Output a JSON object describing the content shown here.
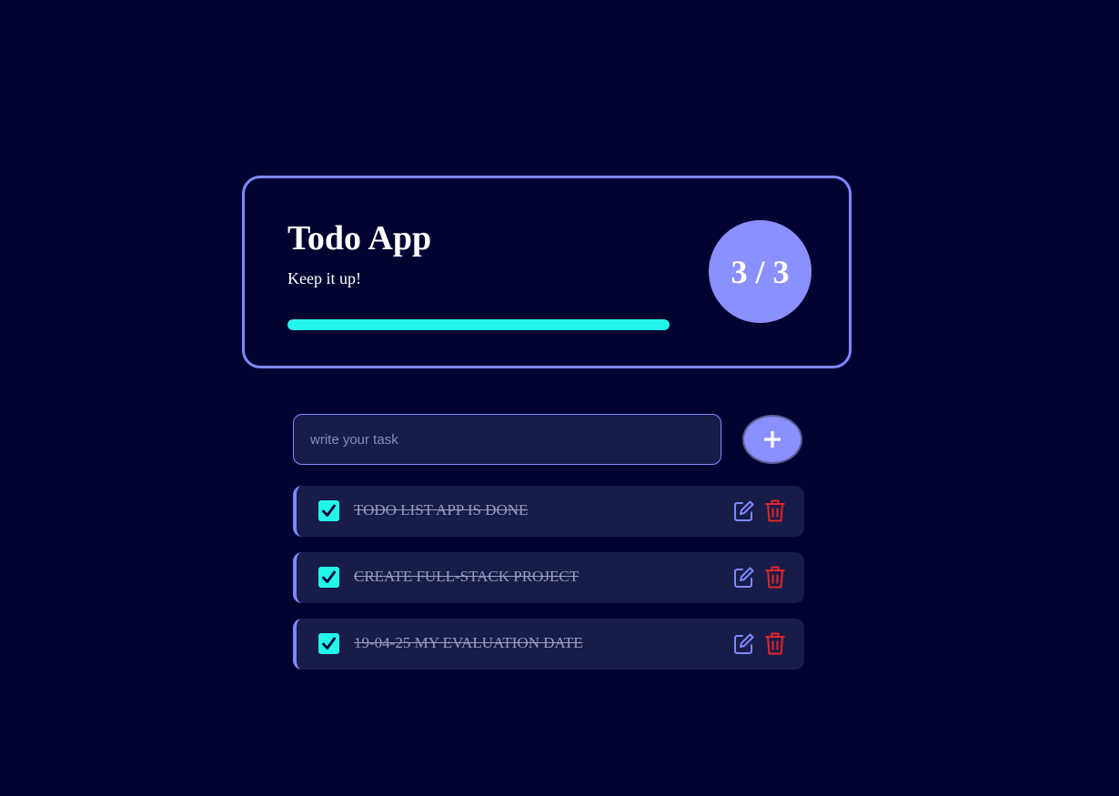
{
  "header": {
    "title": "Todo App",
    "subtitle": "Keep it up!",
    "progress_fraction": 1.0,
    "completed_count": 3,
    "total_count": 3,
    "count_label": "3 / 3"
  },
  "input": {
    "placeholder": "write your task",
    "value": "",
    "add_icon": "plus-icon"
  },
  "tasks": [
    {
      "text": "TODO LIST APP IS DONE",
      "completed": true
    },
    {
      "text": "CREATE FULL-STACK PROJECT",
      "completed": true
    },
    {
      "text": "19-04-25 MY EVALUATION DATE",
      "completed": true
    }
  ],
  "icons": {
    "edit": "edit-icon",
    "delete": "trash-icon",
    "check": "check-icon"
  },
  "colors": {
    "background": "#000331",
    "accent": "#7f88ff",
    "progress": "#23f5e9",
    "task_background": "#181c48",
    "delete": "#e2262b"
  }
}
